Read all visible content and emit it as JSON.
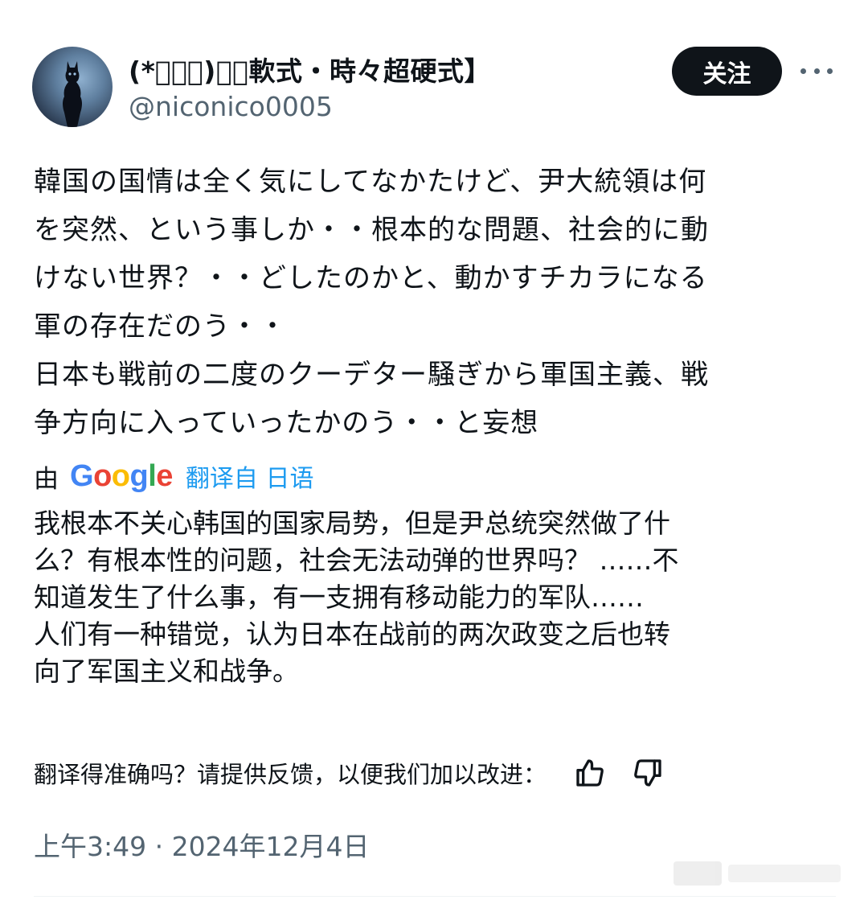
{
  "author": {
    "display_name": "(*ﾟーﾟ)／【軟式・時々超硬式】",
    "handle": "@niconico0005"
  },
  "header": {
    "follow_label": "关注"
  },
  "tweet": {
    "original_lines": [
      "韓国の国情は全く気にしてなかたけど、尹大統領は何",
      "を突然、という事しか・・根本的な問題、社会的に動",
      "けない世界？・・どしたのかと、動かすチカラになる",
      "軍の存在だのう・・",
      "日本も戦前の二度のクーデター騒ぎから軍国主義、戦",
      "争方向に入っていったかのう・・と妄想"
    ],
    "translated_by": {
      "prefix": "由",
      "provider": "Google",
      "link_text": "翻译自 日语"
    },
    "translated_lines": [
      "我根本不关心韩国的国家局势，但是尹总统突然做了什",
      "么？有根本性的问题，社会无法动弹的世界吗？ ……不",
      "知道发生了什么事，有一支拥有移动能力的军队……",
      "人们有一种错觉，认为日本在战前的两次政变之后也转",
      "向了军国主义和战争。"
    ],
    "feedback_prompt": "翻译得准确吗？请提供反馈，以便我们加以改进：",
    "timestamp": "上午3:49 · 2024年12月4日"
  },
  "icons": {
    "more": "more-horizontal-icon",
    "thumbs_up": "thumbs-up-icon",
    "thumbs_down": "thumbs-down-icon"
  },
  "colors": {
    "text": "#0f1419",
    "secondary": "#536471",
    "link": "#1d9bf0",
    "follow_bg": "#0f1419",
    "google_blue": "#4285F4",
    "google_red": "#EA4335",
    "google_yellow": "#FBBC05",
    "google_green": "#34A853"
  }
}
